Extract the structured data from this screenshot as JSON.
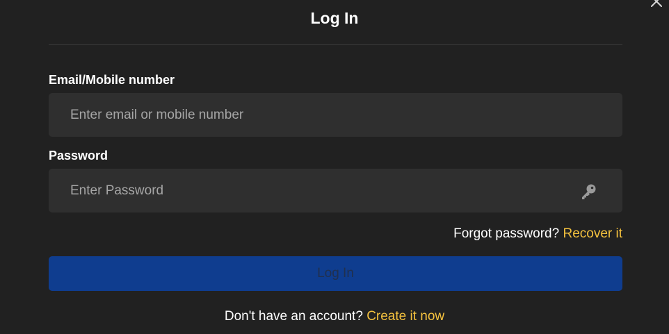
{
  "modal": {
    "title": "Log In",
    "close_icon": "close-icon"
  },
  "email": {
    "label": "Email/Mobile number",
    "value": "",
    "placeholder": "Enter email or mobile number"
  },
  "password": {
    "label": "Password",
    "value": "",
    "placeholder": "Enter Password",
    "toggle_icon": "key-icon"
  },
  "forgot": {
    "prompt": "Forgot password?",
    "link_label": "Recover it"
  },
  "submit": {
    "label": "Log In"
  },
  "signup": {
    "prompt": "Don't have an account?",
    "link_label": "Create it now"
  },
  "colors": {
    "background": "#212121",
    "field_background": "#2f2f2f",
    "accent_link": "#f5c23e",
    "button_background": "#0f3d8f"
  }
}
